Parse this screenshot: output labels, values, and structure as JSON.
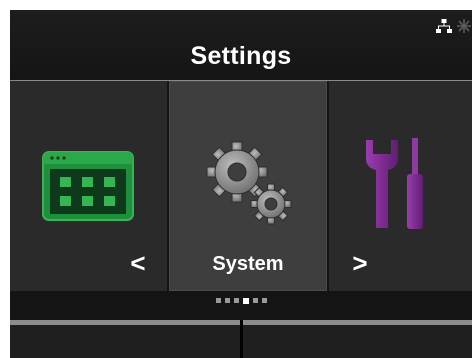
{
  "header": {
    "title": "Settings",
    "status_icons": [
      "network-icon",
      "signal-icon"
    ]
  },
  "carousel": {
    "items": [
      {
        "icon": "app-window-icon",
        "label": "",
        "color": "#2fa24a"
      },
      {
        "icon": "gears-icon",
        "label": "System",
        "color": "#9a9a9a",
        "selected": true
      },
      {
        "icon": "tools-icon",
        "label": "",
        "color": "#7b2a8f"
      }
    ],
    "prev_arrow": "<",
    "next_arrow": ">"
  },
  "pagination": {
    "total": 6,
    "active_index": 3
  },
  "softkeys": {
    "left": "",
    "right": ""
  },
  "colors": {
    "background": "#141414",
    "tile": "#2a2a2a",
    "tile_selected": "#3e3e3e",
    "softkey_bar": "#8c8c8c"
  }
}
